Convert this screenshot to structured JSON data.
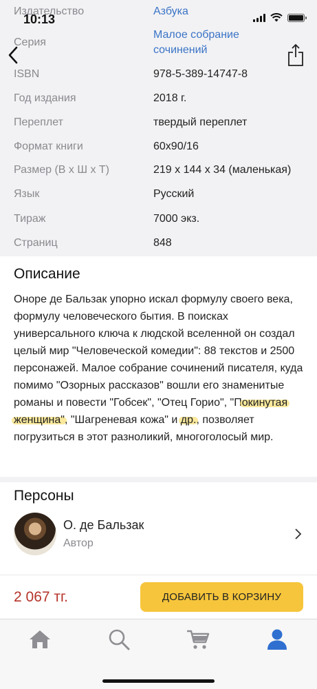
{
  "status_bar": {
    "time": "10:13"
  },
  "specs": [
    {
      "label": "Издательство",
      "value": "Азбука",
      "link": true
    },
    {
      "label": "Серия",
      "value": "Малое собрание сочинений",
      "link": true
    },
    {
      "label": "ISBN",
      "value": "978-5-389-14747-8",
      "link": false
    },
    {
      "label": "Год издания",
      "value": "2018 г.",
      "link": false
    },
    {
      "label": "Переплет",
      "value": "твердый переплет",
      "link": false
    },
    {
      "label": "Формат книги",
      "value": "60x90/16",
      "link": false
    },
    {
      "label": "Размер (В х Ш х Т)",
      "value": "219 x 144 x 34 (маленькая)",
      "link": false
    },
    {
      "label": "Язык",
      "value": "Русский",
      "link": false
    },
    {
      "label": "Тираж",
      "value": "7000 экз.",
      "link": false
    },
    {
      "label": "Страниц",
      "value": "848",
      "link": false
    }
  ],
  "series_value_lines": [
    "Малое собрание",
    "сочинений"
  ],
  "description": {
    "title": "Описание",
    "text_before": "Оноре де Бальзак упорно искал формулу своего века, формулу человеческого бытия. В поисках универсального ключа к людской вселенной он создал целый мир \"Человеческой комедии\": 88 текстов и 2500 персонажей. Малое собрание сочинений писателя, куда помимо \"Озорных рассказов\" вошли его знаменитые романы и повести \"Гобсек\", \"Отец Горио\", \"П",
    "highlight_1": "окинутая",
    "highlight_2": "женщина\"",
    "text_middle": ", \"Шагреневая кожа\" и ",
    "highlight_3": "др.",
    "text_after": ", позволяет погрузиться в этот разноликий, многоголосый мир."
  },
  "persons": {
    "title": "Персоны",
    "items": [
      {
        "name": "О. де Бальзак",
        "role": "Автор"
      }
    ]
  },
  "buy": {
    "price": "2 067 тг.",
    "button_label": "ДОБАВИТЬ В КОРЗИНУ"
  },
  "colors": {
    "accent": "#f6c53b",
    "price": "#b5332a",
    "link": "#3a73c6",
    "active_tab": "#2f6fd0",
    "inactive_tab": "#8e8e93"
  },
  "tabs": [
    {
      "icon": "home-icon",
      "active": false
    },
    {
      "icon": "search-icon",
      "active": false
    },
    {
      "icon": "cart-icon",
      "active": false
    },
    {
      "icon": "profile-icon",
      "active": true
    }
  ]
}
